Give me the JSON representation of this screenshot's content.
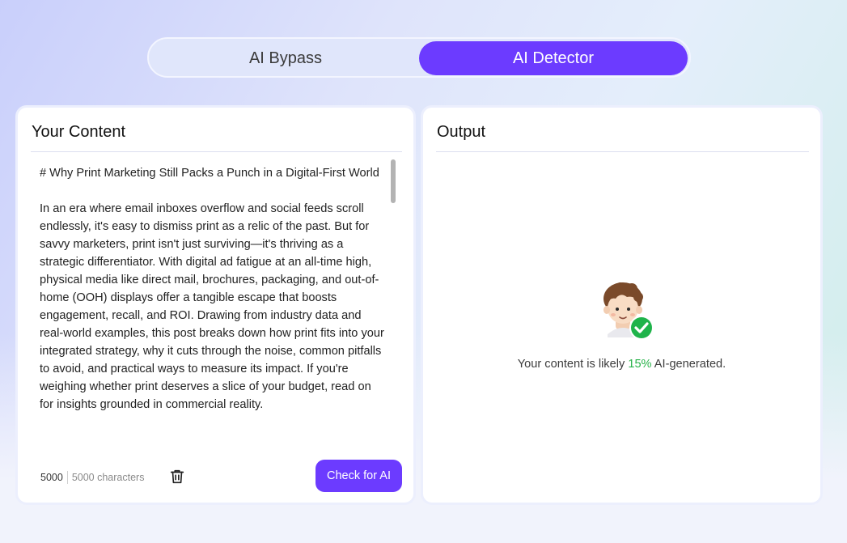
{
  "tabs": [
    {
      "label": "AI Bypass",
      "active": false
    },
    {
      "label": "AI Detector",
      "active": true
    }
  ],
  "input_panel": {
    "title": "Your Content",
    "text": "# Why Print Marketing Still Packs a Punch in a Digital-First World\n\nIn an era where email inboxes overflow and social feeds scroll endlessly, it's easy to dismiss print as a relic of the past. But for savvy marketers, print isn't just surviving—it's thriving as a strategic differentiator. With digital ad fatigue at an all-time high, physical media like direct mail, brochures, packaging, and out-of-home (OOH) displays offer a tangible escape that boosts engagement, recall, and ROI. Drawing from industry data and real-world examples, this post breaks down how print fits into your integrated strategy, why it cuts through the noise, common pitfalls to avoid, and practical ways to measure its impact. If you're weighing whether print deserves a slice of your budget, read on for insights grounded in commercial reality.",
    "char_count": "5000",
    "char_limit": "5000 characters",
    "delete_icon": "trash-icon",
    "check_button": "Check for AI"
  },
  "output_panel": {
    "title": "Output",
    "avatar_icon": "person-check-icon",
    "result_prefix": "Your content is likely ",
    "result_percent": "15%",
    "result_suffix": " AI-generated."
  },
  "colors": {
    "accent": "#6c3bff",
    "success": "#29b34a"
  }
}
